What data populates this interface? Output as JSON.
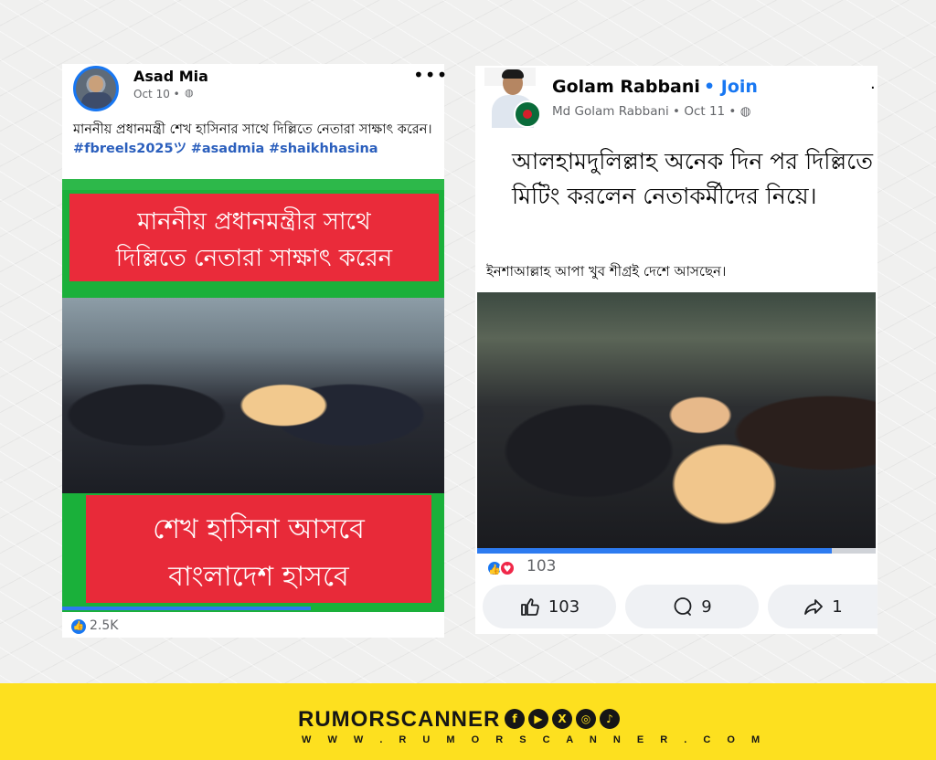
{
  "left_post": {
    "author": "Asad Mia",
    "date": "Oct 10 •",
    "more": "•••",
    "text": "মাননীয় প্রধানমন্ত্রী শেখ হাসিনার সাথে দিল্লিতে নেতারা সাক্ষাৎ করেন। ",
    "hashtags": [
      "#fbreels2025ツ",
      "#asadmia",
      "#shaikhhasina"
    ],
    "video": {
      "banner_top": [
        "মাননীয় প্রধানমন্ত্রীর সাথে",
        "দিল্লিতে নেতারা সাক্ষাৎ করেন"
      ],
      "banner_bottom": [
        "শেখ হাসিনা আসবে",
        "বাংলাদেশ হাসবে"
      ],
      "progress": 0.65
    },
    "likes": "2.5K"
  },
  "right_post": {
    "author": "Golam Rabbani",
    "join": "• Join",
    "sub": "Md Golam Rabbani • Oct 11 •",
    "text_main": "আলহামদুলিল্লাহ অনেক দিন পর দিল্লিতে মিটিং করলেন নেতাকর্মীদের নিয়ে।",
    "text_secondary": "ইনশাআল্লাহ আপা খুব শীগ্রই দেশে আসছেন।",
    "video": {
      "progress": 0.89
    },
    "reaction_count": "103",
    "actions": {
      "like": "103",
      "comment": "9",
      "share": "1"
    }
  },
  "footer": {
    "brand": "RUMORSCANNER",
    "url": "W W W . R U M O R S C A N N E R . C O M",
    "social_icons": [
      "facebook-icon",
      "youtube-icon",
      "x-icon",
      "instagram-icon",
      "tiktok-icon"
    ]
  },
  "colors": {
    "facebook_blue": "#1877f2",
    "banner_red": "#ea2b3a",
    "banner_green": "#1ab03a",
    "footer_yellow": "#fde01f"
  }
}
